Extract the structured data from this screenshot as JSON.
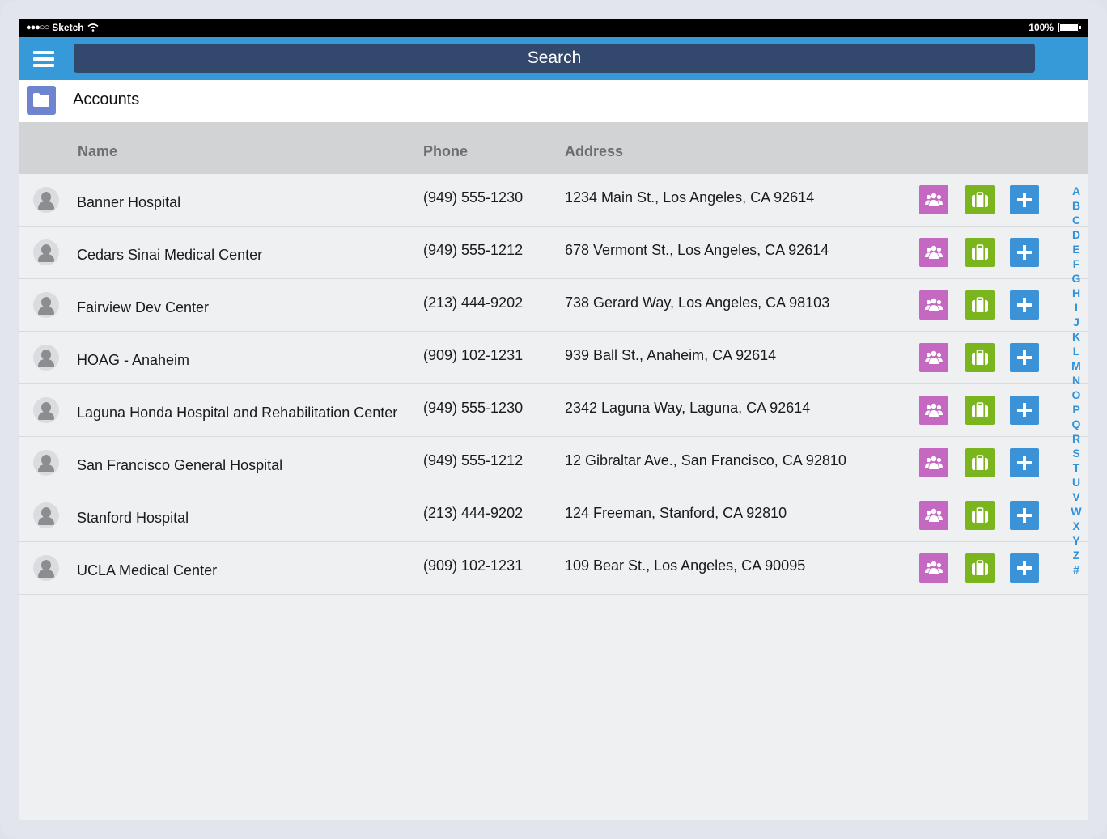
{
  "status_bar": {
    "carrier": "Sketch",
    "battery": "100%"
  },
  "search": {
    "placeholder": "Search"
  },
  "page": {
    "title": "Accounts"
  },
  "table": {
    "headers": {
      "name": "Name",
      "phone": "Phone",
      "address": "Address"
    },
    "rows": [
      {
        "name": "Banner Hospital",
        "phone": "(949) 555-1230",
        "address": "1234 Main St., Los Angeles, CA 92614"
      },
      {
        "name": "Cedars Sinai Medical Center",
        "phone": "(949) 555-1212",
        "address": "678 Vermont St., Los Angeles, CA 92614"
      },
      {
        "name": "Fairview Dev Center",
        "phone": "(213) 444-9202",
        "address": "738 Gerard Way, Los Angeles, CA 98103"
      },
      {
        "name": "HOAG - Anaheim",
        "phone": "(909) 102-1231",
        "address": "939 Ball St., Anaheim, CA 92614"
      },
      {
        "name": "Laguna Honda Hospital and Rehabilitation Center",
        "phone": "(949) 555-1230",
        "address": "2342 Laguna Way, Laguna, CA 92614"
      },
      {
        "name": "San Francisco General Hospital",
        "phone": "(949) 555-1212",
        "address": "12 Gibraltar Ave., San Francisco, CA 92810"
      },
      {
        "name": "Stanford Hospital",
        "phone": "(213) 444-9202",
        "address": "124 Freeman, Stanford, CA 92810"
      },
      {
        "name": "UCLA Medical Center",
        "phone": "(909) 102-1231",
        "address": "109 Bear St., Los Angeles, CA 90095"
      }
    ]
  },
  "alpha_index": [
    "A",
    "B",
    "C",
    "D",
    "E",
    "F",
    "G",
    "H",
    "I",
    "J",
    "K",
    "L",
    "M",
    "N",
    "O",
    "P",
    "Q",
    "R",
    "S",
    "T",
    "U",
    "V",
    "W",
    "X",
    "Y",
    "Z",
    "#"
  ],
  "colors": {
    "navbar": "#3699d8",
    "search_bg": "#33486d",
    "contacts_action": "#c468c2",
    "case_action": "#7ab51d",
    "add_action": "#3b92d6",
    "index_letters": "#3391d8"
  },
  "icons": {
    "menu": "hamburger-icon",
    "page": "folder-icon",
    "row_avatar": "user-avatar-icon",
    "action_contacts": "contacts-icon",
    "action_case": "briefcase-icon",
    "action_add": "plus-icon"
  }
}
